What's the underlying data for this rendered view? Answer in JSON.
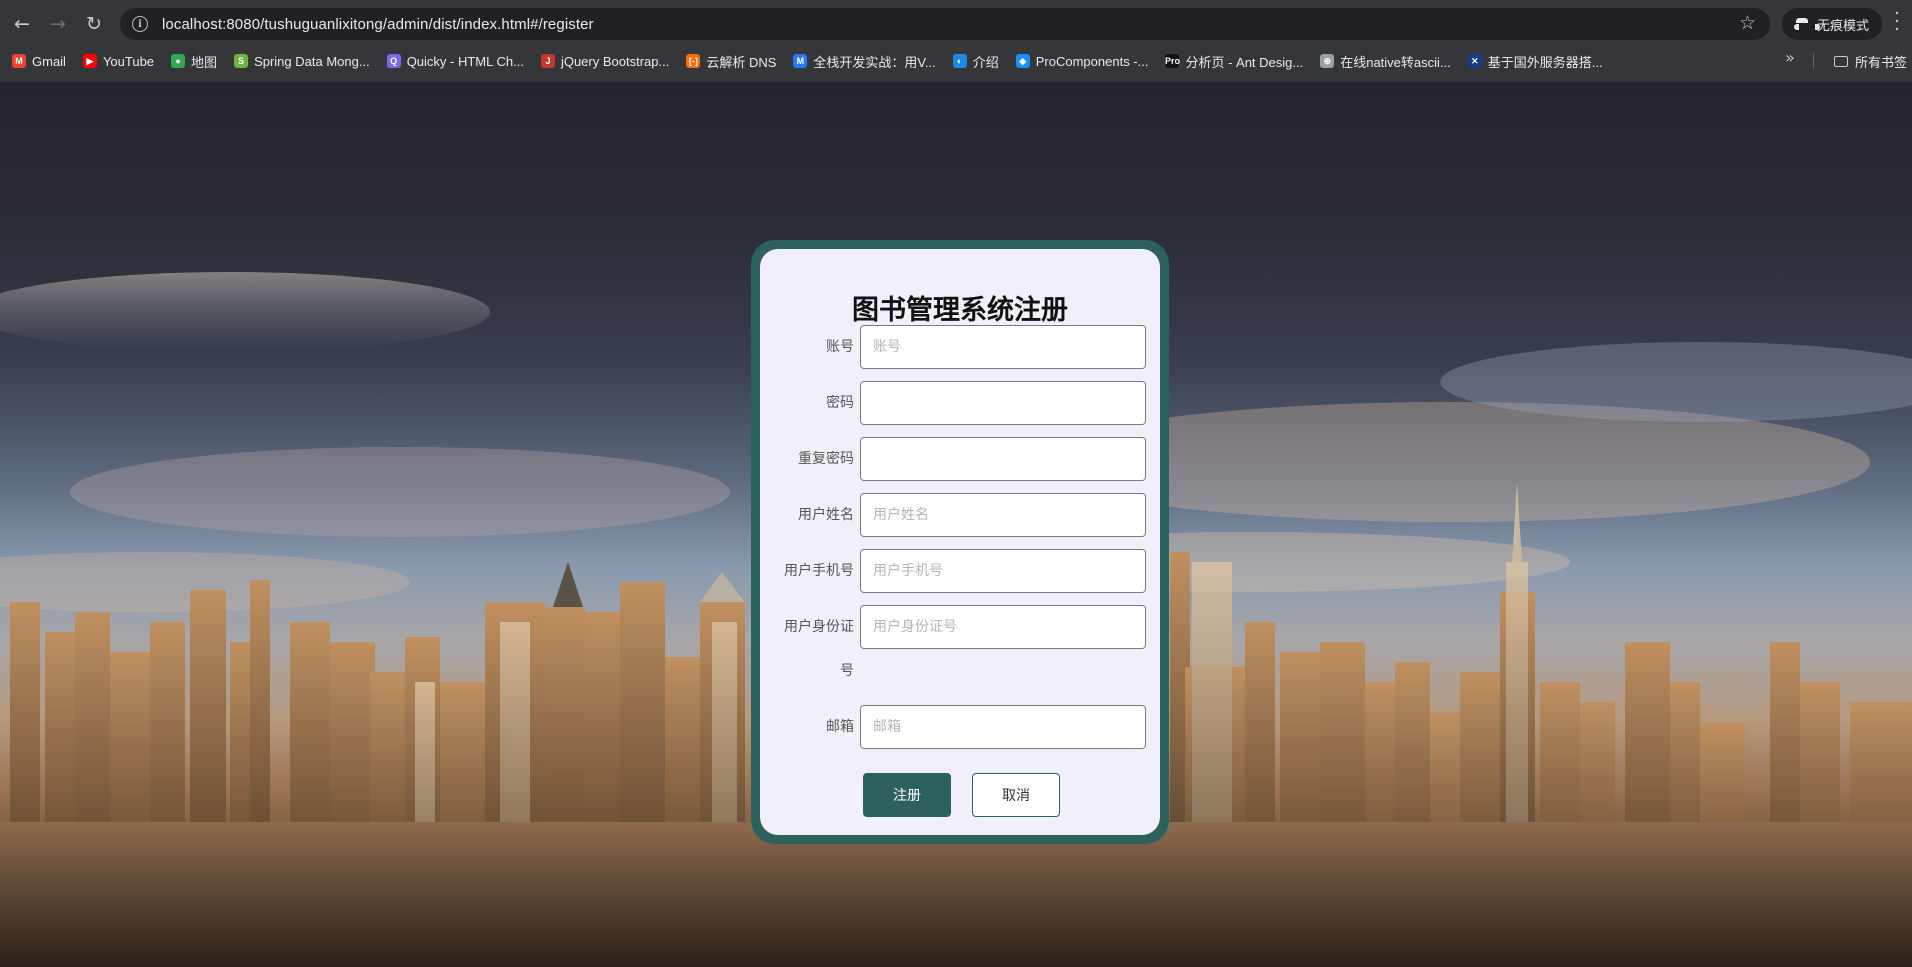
{
  "browser": {
    "url": "localhost:8080/tushuguanlixitong/admin/dist/index.html#/register",
    "incognito_label": "无痕模式",
    "bookmarks": [
      {
        "label": "Gmail",
        "icon": "gmail-icon",
        "color": "#ea4335",
        "glyph": "M"
      },
      {
        "label": "YouTube",
        "icon": "youtube-icon",
        "color": "#ff0000",
        "glyph": "▶"
      },
      {
        "label": "地图",
        "icon": "maps-icon",
        "color": "#34a853",
        "glyph": "●"
      },
      {
        "label": "Spring Data Mong...",
        "icon": "spring-icon",
        "color": "#6db33f",
        "glyph": "S"
      },
      {
        "label": "Quicky - HTML Ch...",
        "icon": "quicky-icon",
        "color": "#7b68ee",
        "glyph": "Q"
      },
      {
        "label": "jQuery Bootstrap...",
        "icon": "jquery-icon",
        "color": "#c0392b",
        "glyph": "J"
      },
      {
        "label": "云解析 DNS",
        "icon": "aliyun-icon",
        "color": "#ff6a00",
        "glyph": "[-]"
      },
      {
        "label": "全栈开发实战：用V...",
        "icon": "m-icon",
        "color": "#2979ff",
        "glyph": "M"
      },
      {
        "label": "介绍",
        "icon": "intro-icon",
        "color": "#1e88e5",
        "glyph": "◐"
      },
      {
        "label": "ProComponents -...",
        "icon": "procomponents-icon",
        "color": "#1890ff",
        "glyph": "◆"
      },
      {
        "label": "分析页 - Ant Desig...",
        "icon": "pro-icon",
        "color": "#111111",
        "glyph": "Pro"
      },
      {
        "label": "在线native转ascii...",
        "icon": "globe-icon",
        "color": "#9aa0a6",
        "glyph": "⊕"
      },
      {
        "label": "基于国外服务器搭...",
        "icon": "flag-icon",
        "color": "#1a3a8a",
        "glyph": "✕"
      }
    ],
    "all_bookmarks_label": "所有书签"
  },
  "form": {
    "title": "图书管理系统注册",
    "fields": [
      {
        "label": "账号",
        "placeholder": "账号",
        "value": ""
      },
      {
        "label": "密码",
        "placeholder": "",
        "value": ""
      },
      {
        "label": "重复密码",
        "placeholder": "",
        "value": ""
      },
      {
        "label": "用户姓名",
        "placeholder": "用户姓名",
        "value": ""
      },
      {
        "label": "用户手机号",
        "placeholder": "用户手机号",
        "value": ""
      },
      {
        "label": "用户身份证号",
        "placeholder": "用户身份证号",
        "value": ""
      },
      {
        "label": "邮箱",
        "placeholder": "邮箱",
        "value": ""
      }
    ],
    "register_label": "注册",
    "cancel_label": "取消"
  },
  "colors": {
    "card_border": "#2c615e",
    "card_bg": "#f1f0fa",
    "primary_button": "#2c615e"
  }
}
